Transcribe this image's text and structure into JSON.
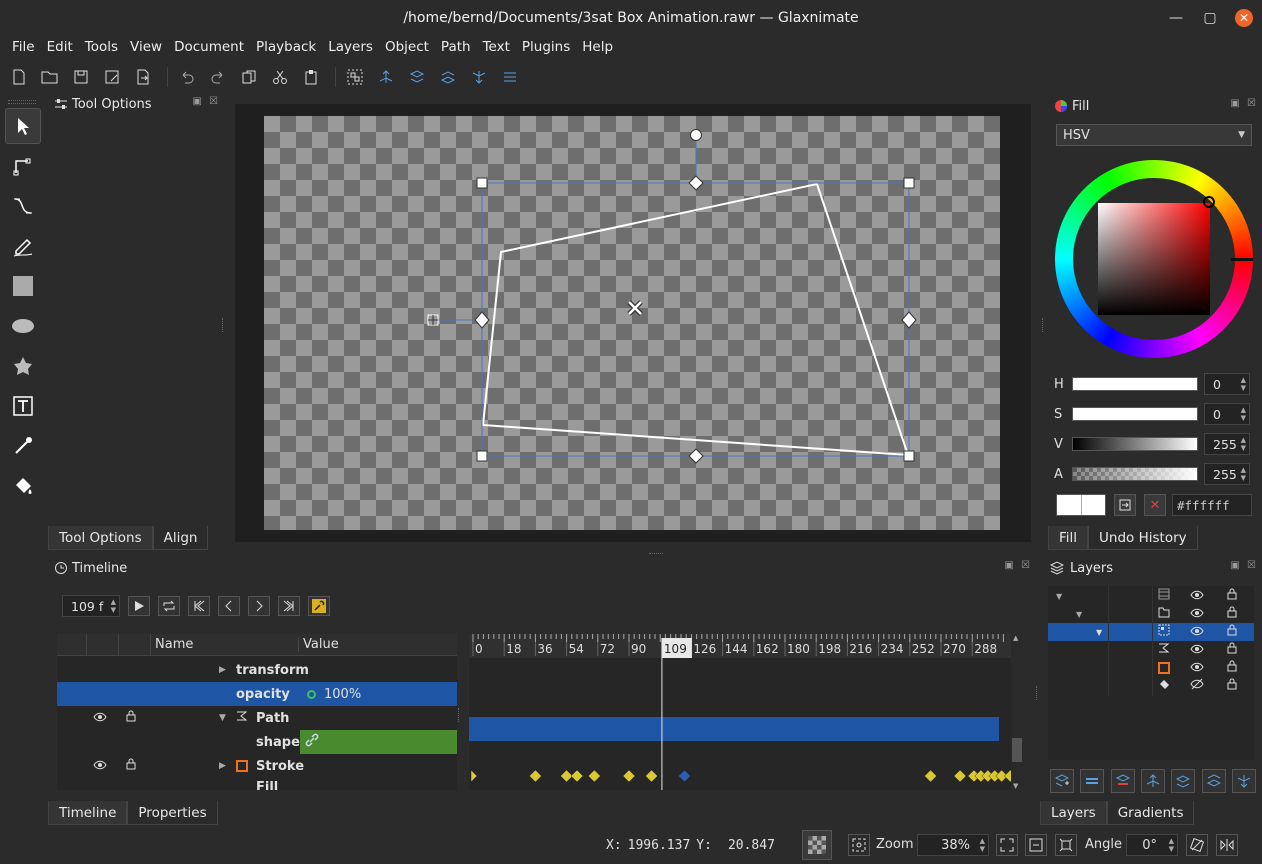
{
  "window": {
    "title": "/home/bernd/Documents/3sat Box Animation.rawr — Glaxnimate"
  },
  "menu": [
    "File",
    "Edit",
    "Tools",
    "View",
    "Document",
    "Playback",
    "Layers",
    "Object",
    "Path",
    "Text",
    "Plugins",
    "Help"
  ],
  "tool_options": {
    "title": "Tool Options",
    "tabs": [
      "Tool Options",
      "Align"
    ]
  },
  "fill": {
    "title": "Fill",
    "mode": "HSV",
    "h": "0",
    "s": "0",
    "v": "255",
    "a": "255",
    "hex": "#ffffff",
    "tabs": [
      "Fill",
      "Undo History"
    ]
  },
  "timeline": {
    "title": "Timeline",
    "frame": "109 f",
    "columns": {
      "name": "Name",
      "value": "Value"
    },
    "rows": [
      {
        "name": "transform",
        "value": ""
      },
      {
        "name": "opacity",
        "value": "100%"
      },
      {
        "name": "Path",
        "value": ""
      },
      {
        "name": "shape",
        "value": ""
      },
      {
        "name": "Stroke",
        "value": ""
      },
      {
        "name": "Fill",
        "value": ""
      }
    ],
    "ruler": [
      "0",
      "18",
      "36",
      "54",
      "72",
      "90",
      "109",
      "126",
      "144",
      "162",
      "180",
      "198",
      "216",
      "234",
      "252",
      "270",
      "288"
    ],
    "current_frame": 109,
    "keyframes": [
      0,
      36,
      54,
      60,
      70,
      90,
      103,
      122,
      264,
      281,
      289,
      293,
      297,
      301,
      305,
      310
    ],
    "tabs": [
      "Timeline",
      "Properties"
    ]
  },
  "layers": {
    "title": "Layers",
    "tabs": [
      "Layers",
      "Gradients"
    ]
  },
  "status": {
    "x_label": "X:",
    "x": "1996.137",
    "y_label": "Y:",
    "y": "20.847",
    "zoom_label": "Zoom",
    "zoom": "38%",
    "angle_label": "Angle",
    "angle": "0°"
  },
  "colors": {
    "accent": "#1e55a5",
    "keyframe": "#d9c832",
    "shape_value": "#4a8a2e"
  }
}
